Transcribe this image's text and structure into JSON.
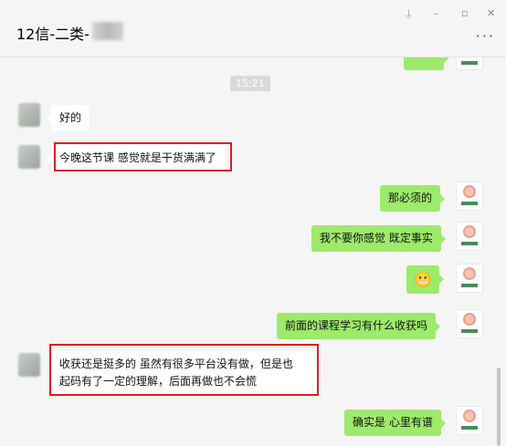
{
  "window": {
    "title": "12信-二类-",
    "controls": [
      "⍊",
      "–",
      "▫",
      "✕"
    ],
    "more": "···"
  },
  "chat": {
    "timestamp": "15:21",
    "messages": [
      {
        "side": "left",
        "text": "好的"
      },
      {
        "side": "left",
        "text": "今晚这节课 感觉就是干货满满了",
        "highlighted": true
      },
      {
        "side": "right",
        "text": "那必须的"
      },
      {
        "side": "right",
        "text": "我不要你感觉 既定事实"
      },
      {
        "side": "right",
        "text": "😬",
        "emoji": "grimacing-face"
      },
      {
        "side": "right",
        "text": "前面的课程学习有什么收获吗"
      },
      {
        "side": "left",
        "line1": "收获还是挺多的  虽然有很多平台没有做，但是也",
        "line2": "起码有了一定的理解，后面再做也不会慌",
        "highlighted": true
      },
      {
        "side": "right",
        "text": "确实是 心里有谱"
      }
    ]
  },
  "colors": {
    "right_bubble": "#9eea6a",
    "highlight": "#d9201c",
    "background": "#f5f5f5"
  }
}
